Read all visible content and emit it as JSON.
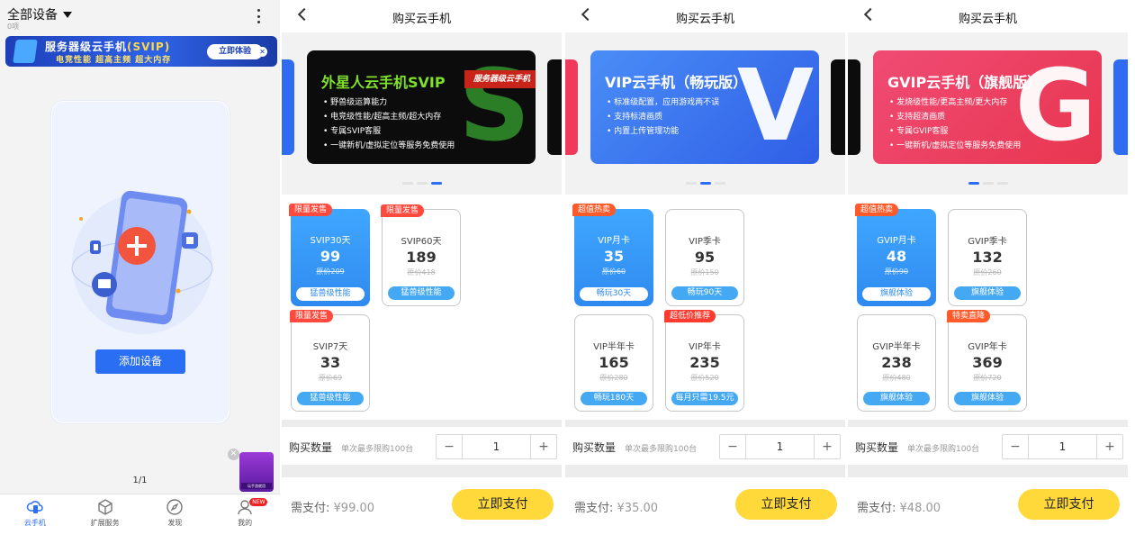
{
  "home": {
    "title": "全部设备",
    "count": "0项",
    "promo": {
      "title": "服务器级云手机",
      "badge": "(SVIP)",
      "subtitle": "电竞性能  超高主频  超大内存",
      "button": "立即体验"
    },
    "add_device": "添加设备",
    "pager": "1/1",
    "float_ad_label": "玩手游就用",
    "tabs": [
      {
        "label": "云手机",
        "icon": "cloud-phone-icon",
        "active": true
      },
      {
        "label": "扩展服务",
        "icon": "cube-icon",
        "active": false
      },
      {
        "label": "发现",
        "icon": "compass-icon",
        "active": false
      },
      {
        "label": "我的",
        "icon": "user-icon",
        "active": false,
        "badge": "NEW"
      }
    ]
  },
  "panels": [
    {
      "title": "购买云手机",
      "banner": {
        "title": "外星人云手机SVIP",
        "tag": "服务器级云手机",
        "bullets": [
          "野兽级运算能力",
          "电竞级性能/超高主频/超大内存",
          "专属SVIP客服",
          "一键新机/虚拟定位等服务免费使用"
        ],
        "letter": "S",
        "colors": {
          "bg": "#0c0c0c",
          "letter": "#2f8a2a",
          "tag": "#c9241a",
          "title": "#7ee02d"
        }
      },
      "dots_active": 2,
      "cards": [
        {
          "ribbon": "限量发售",
          "name": "SVIP30天",
          "price": "99",
          "orig": "原价209",
          "perk": "猛兽级性能",
          "selected": true
        },
        {
          "ribbon": "限量发售",
          "name": "SVIP60天",
          "price": "189",
          "orig": "原价418",
          "perk": "猛兽级性能",
          "selected": false
        },
        {
          "ribbon": "限量发售",
          "name": "SVIP7天",
          "price": "33",
          "orig": "原价69",
          "perk": "猛兽级性能",
          "selected": false
        }
      ],
      "qty_label": "购买数量",
      "qty_note": "单次最多限购100台",
      "qty_value": "1",
      "pay_label": "需支付:",
      "pay_amount": "¥99.00",
      "pay_button": "立即支付"
    },
    {
      "title": "购买云手机",
      "banner": {
        "title": "VIP云手机（畅玩版）",
        "tag": "",
        "bullets": [
          "标准级配置，应用游戏两不误",
          "支持标清画质",
          "内置上传管理功能"
        ],
        "letter": "V",
        "colors": {
          "bg": "#2f6cf2",
          "letter": "#ffffff",
          "tag": "",
          "title": "#ffffff"
        }
      },
      "dots_active": 1,
      "cards": [
        {
          "ribbon": "超值热卖",
          "name": "VIP月卡",
          "price": "35",
          "orig": "原价60",
          "perk": "畅玩30天",
          "selected": true
        },
        {
          "ribbon": "",
          "name": "VIP季卡",
          "price": "95",
          "orig": "原价150",
          "perk": "畅玩90天",
          "selected": false
        },
        {
          "ribbon": "",
          "name": "VIP半年卡",
          "price": "165",
          "orig": "原价280",
          "perk": "畅玩180天",
          "selected": false
        },
        {
          "ribbon": "超低价推荐",
          "name": "VIP年卡",
          "price": "235",
          "orig": "原价520",
          "perk": "每月只需19.5元",
          "selected": false
        }
      ],
      "qty_label": "购买数量",
      "qty_note": "单次最多限购100台",
      "qty_value": "1",
      "pay_label": "需支付:",
      "pay_amount": "¥35.00",
      "pay_button": "立即支付"
    },
    {
      "title": "购买云手机",
      "banner": {
        "title": "GVIP云手机（旗舰版）",
        "tag": "",
        "bullets": [
          "发烧级性能/更高主频/更大内存",
          "支持超清画质",
          "专属GVIP客服",
          "一键新机/虚拟定位等服务免费使用"
        ],
        "letter": "G",
        "colors": {
          "bg": "#f03a5c",
          "letter": "#ffffff",
          "tag": "",
          "title": "#ffffff"
        }
      },
      "dots_active": 0,
      "cards": [
        {
          "ribbon": "超值热卖",
          "name": "GVIP月卡",
          "price": "48",
          "orig": "原价90",
          "perk": "旗舰体验",
          "selected": true
        },
        {
          "ribbon": "",
          "name": "GVIP季卡",
          "price": "132",
          "orig": "原价260",
          "perk": "旗舰体验",
          "selected": false
        },
        {
          "ribbon": "",
          "name": "GVIP半年卡",
          "price": "238",
          "orig": "原价480",
          "perk": "旗舰体验",
          "selected": false
        },
        {
          "ribbon": "特卖直降",
          "name": "GVIP年卡",
          "price": "369",
          "orig": "原价720",
          "perk": "旗舰体验",
          "selected": false
        }
      ],
      "qty_label": "购买数量",
      "qty_note": "单次最多限购100台",
      "qty_value": "1",
      "pay_label": "需支付:",
      "pay_amount": "¥48.00",
      "pay_button": "立即支付"
    }
  ]
}
